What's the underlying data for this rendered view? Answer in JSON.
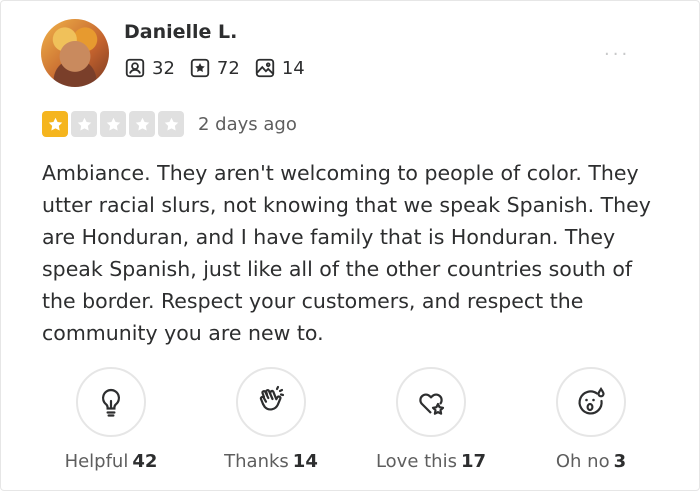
{
  "user": {
    "name": "Danielle L.",
    "friends_count": "32",
    "reviews_count": "72",
    "photos_count": "14"
  },
  "more_menu": "...",
  "rating": {
    "stars": 1,
    "max": 5,
    "date": "2 days ago",
    "accent": "#f5b51e"
  },
  "review_text": "Ambiance. They aren't welcoming to people of color. They utter racial slurs, not knowing that we speak Spanish. They are Honduran, and I have family that is Honduran. They speak Spanish, just like all of the other countries south of the border. Respect your customers, and respect the community you are new to.",
  "reactions": [
    {
      "icon": "lightbulb-icon",
      "label": "Helpful",
      "count": "42"
    },
    {
      "icon": "clapping-hands-icon",
      "label": "Thanks",
      "count": "14"
    },
    {
      "icon": "heart-sparkle-icon",
      "label": "Love this",
      "count": "17"
    },
    {
      "icon": "surprised-face-icon",
      "label": "Oh no",
      "count": "3"
    }
  ]
}
